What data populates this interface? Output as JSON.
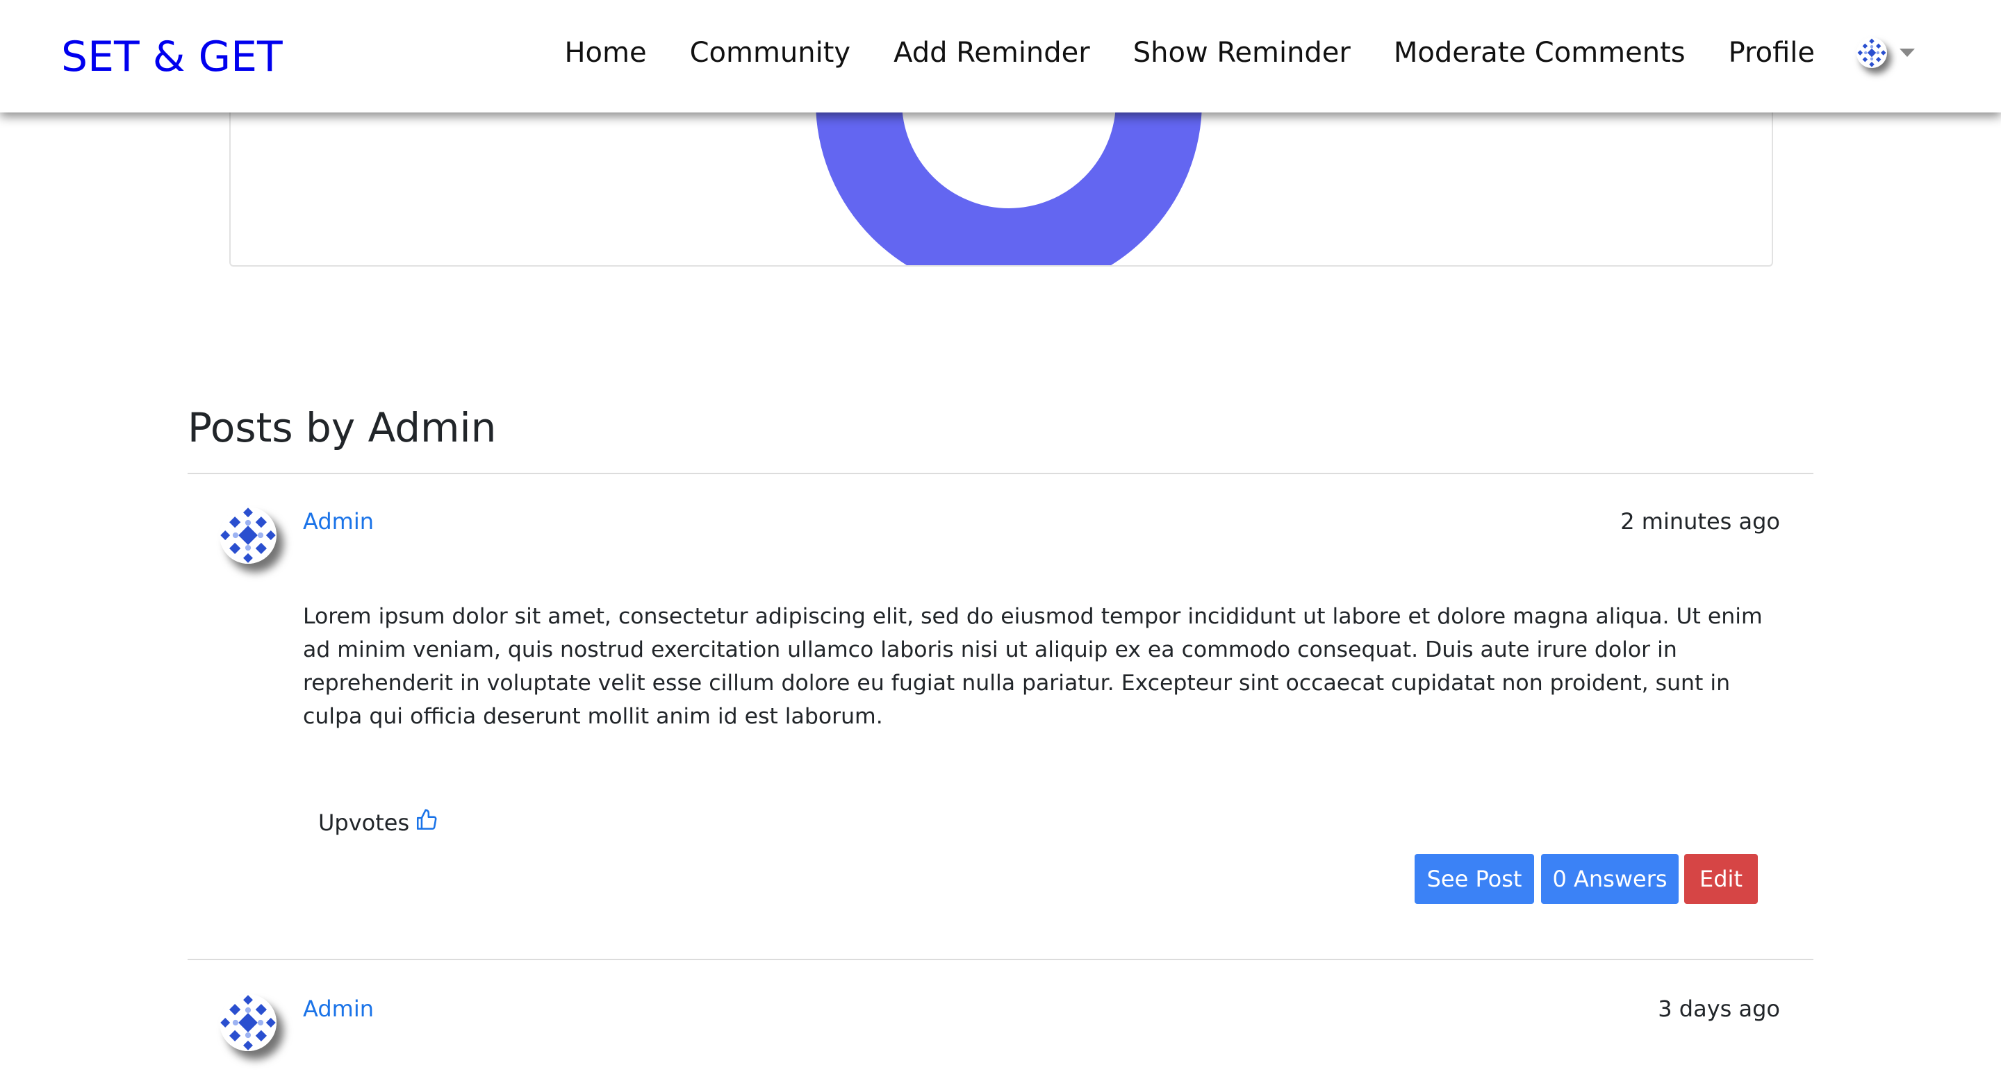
{
  "navbar": {
    "brand": "SET & GET",
    "links": [
      "Home",
      "Community",
      "Add Reminder",
      "Show Reminder",
      "Moderate Comments",
      "Profile"
    ],
    "avatar_icon": "profile-avatar-icon",
    "dropdown_icon": "caret-down-icon"
  },
  "top_card": {
    "chart_color": "#6366f1"
  },
  "posts_section": {
    "title": "Posts by Admin",
    "posts": [
      {
        "author": "Admin",
        "time": "2 minutes ago",
        "body": "Lorem ipsum dolor sit amet, consectetur adipiscing elit, sed do eiusmod tempor incididunt ut labore et dolore magna aliqua. Ut enim ad minim veniam, quis nostrud exercitation ullamco laboris nisi ut aliquip ex ea commodo consequat. Duis aute irure dolor in reprehenderit in voluptate velit esse cillum dolore eu fugiat nulla pariatur. Excepteur sint occaecat cupidatat non proident, sunt in culpa qui officia deserunt mollit anim id est laborum.",
        "upvotes_label": "Upvotes",
        "buttons": {
          "see_post": "See Post",
          "answers": "0 Answers",
          "edit": "Edit"
        }
      },
      {
        "author": "Admin",
        "time": "3 days ago"
      }
    ]
  },
  "colors": {
    "brand": "#0000ee",
    "link": "#1a73e8",
    "primary_button": "#3b82f6",
    "danger_button": "#d64545"
  }
}
